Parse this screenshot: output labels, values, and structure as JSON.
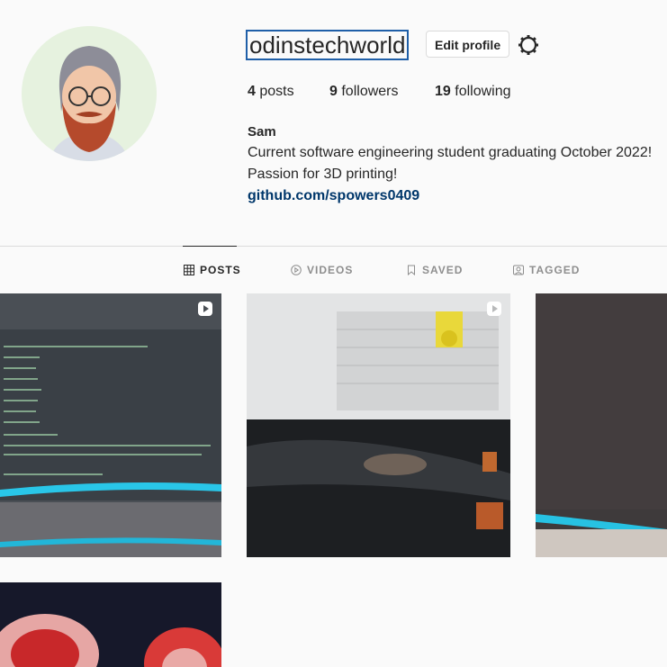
{
  "profile": {
    "username": "odinstechworld",
    "edit_label": "Edit profile",
    "stats": {
      "posts_count": "4",
      "posts_label": "posts",
      "followers_count": "9",
      "followers_label": "followers",
      "following_count": "19",
      "following_label": "following"
    },
    "bio": {
      "name": "Sam",
      "line1": "Current software engineering student graduating October 2022!",
      "line2": "Passion for 3D printing!",
      "link": "github.com/spowers0409"
    }
  },
  "tabs": [
    {
      "label": "POSTS",
      "icon": "grid-icon",
      "active": true
    },
    {
      "label": "VIDEOS",
      "icon": "play-circle-icon",
      "active": false
    },
    {
      "label": "SAVED",
      "icon": "bookmark-icon",
      "active": false
    },
    {
      "label": "TAGGED",
      "icon": "tag-user-icon",
      "active": false
    }
  ],
  "posts": [
    {
      "kind": "video",
      "subject": "code-on-monitor"
    },
    {
      "kind": "video",
      "subject": "3d-printer-part"
    },
    {
      "kind": "image",
      "subject": "dark-monitor"
    },
    {
      "kind": "image",
      "subject": "red-3d-prints"
    }
  ],
  "colors": {
    "link": "#00376b",
    "focus_border": "#1f5fa8",
    "divider": "#dbdbdb"
  }
}
